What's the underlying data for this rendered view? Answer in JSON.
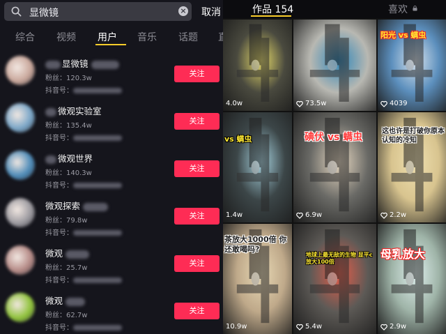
{
  "search": {
    "query": "显微镜",
    "cancel_label": "取消"
  },
  "tabs": [
    {
      "label": "综合"
    },
    {
      "label": "视频"
    },
    {
      "label": "用户"
    },
    {
      "label": "音乐"
    },
    {
      "label": "话题"
    },
    {
      "label": "直"
    }
  ],
  "active_tab": "用户",
  "follow_label": "关注",
  "users": [
    {
      "name": "显微镜",
      "fans": "粉丝：120.3w",
      "id_label": "抖音号：",
      "avatar_color": "#c9a79b"
    },
    {
      "name": "微观实验室",
      "fans": "粉丝：135.4w",
      "id_label": "抖音号：",
      "avatar_color": "#7aa6c8"
    },
    {
      "name": "微观世界",
      "fans": "粉丝：140.3w",
      "id_label": "抖音号：",
      "avatar_color": "#4d8bb8"
    },
    {
      "name": "微观探索",
      "fans": "粉丝：79.8w",
      "id_label": "抖音号：",
      "avatar_color": "#9c9aa0"
    },
    {
      "name": "微观",
      "fans": "粉丝：25.7w",
      "id_label": "抖音号：",
      "avatar_color": "#b58a86"
    },
    {
      "name": "微观",
      "fans": "粉丝：62.7w",
      "id_label": "抖音号：",
      "avatar_color": "#8fc23a"
    }
  ],
  "profile": {
    "works_tab": "作品 154",
    "likes_tab": "喜欢",
    "videos": [
      {
        "count": "4.0w",
        "heart": false,
        "caption": "",
        "bg": "#4a4a3f",
        "accent": "#e8dc6a"
      },
      {
        "count": "73.5w",
        "heart": true,
        "caption": "",
        "bg": "#b8b8b2",
        "accent": "#2f86b8"
      },
      {
        "count": "4039",
        "heart": true,
        "caption": "阳光 vs 螨虫",
        "bg": "#5c8fbd",
        "accent": "#d9e4ee"
      },
      {
        "count": "1.4w",
        "heart": false,
        "caption": "vs 螨虫",
        "bg": "#3c4648",
        "accent": "#a7d3e0"
      },
      {
        "count": "6.9w",
        "heart": true,
        "caption": "碘伏 vs 螨虫",
        "bg": "#6a6a66",
        "accent": "#e8d9c2"
      },
      {
        "count": "2.2w",
        "heart": true,
        "caption": "这也许是打破你原本认知的冷知",
        "bg": "#d8c48f",
        "accent": "#efe0b0"
      },
      {
        "count": "10.9w",
        "heart": false,
        "caption": "茶放大1000倍 你还敢喝吗?",
        "bg": "#bfa98a",
        "accent": "#e8d9b5"
      },
      {
        "count": "5.4w",
        "heart": true,
        "caption": "地球上最无敌的生物 显平c放大100倍",
        "bg": "#5d5a56",
        "accent": "#e55d4a"
      },
      {
        "count": "2.9w",
        "heart": true,
        "caption": "母乳放大",
        "bg": "#9fb4a8",
        "accent": "#dff0ee"
      }
    ]
  }
}
